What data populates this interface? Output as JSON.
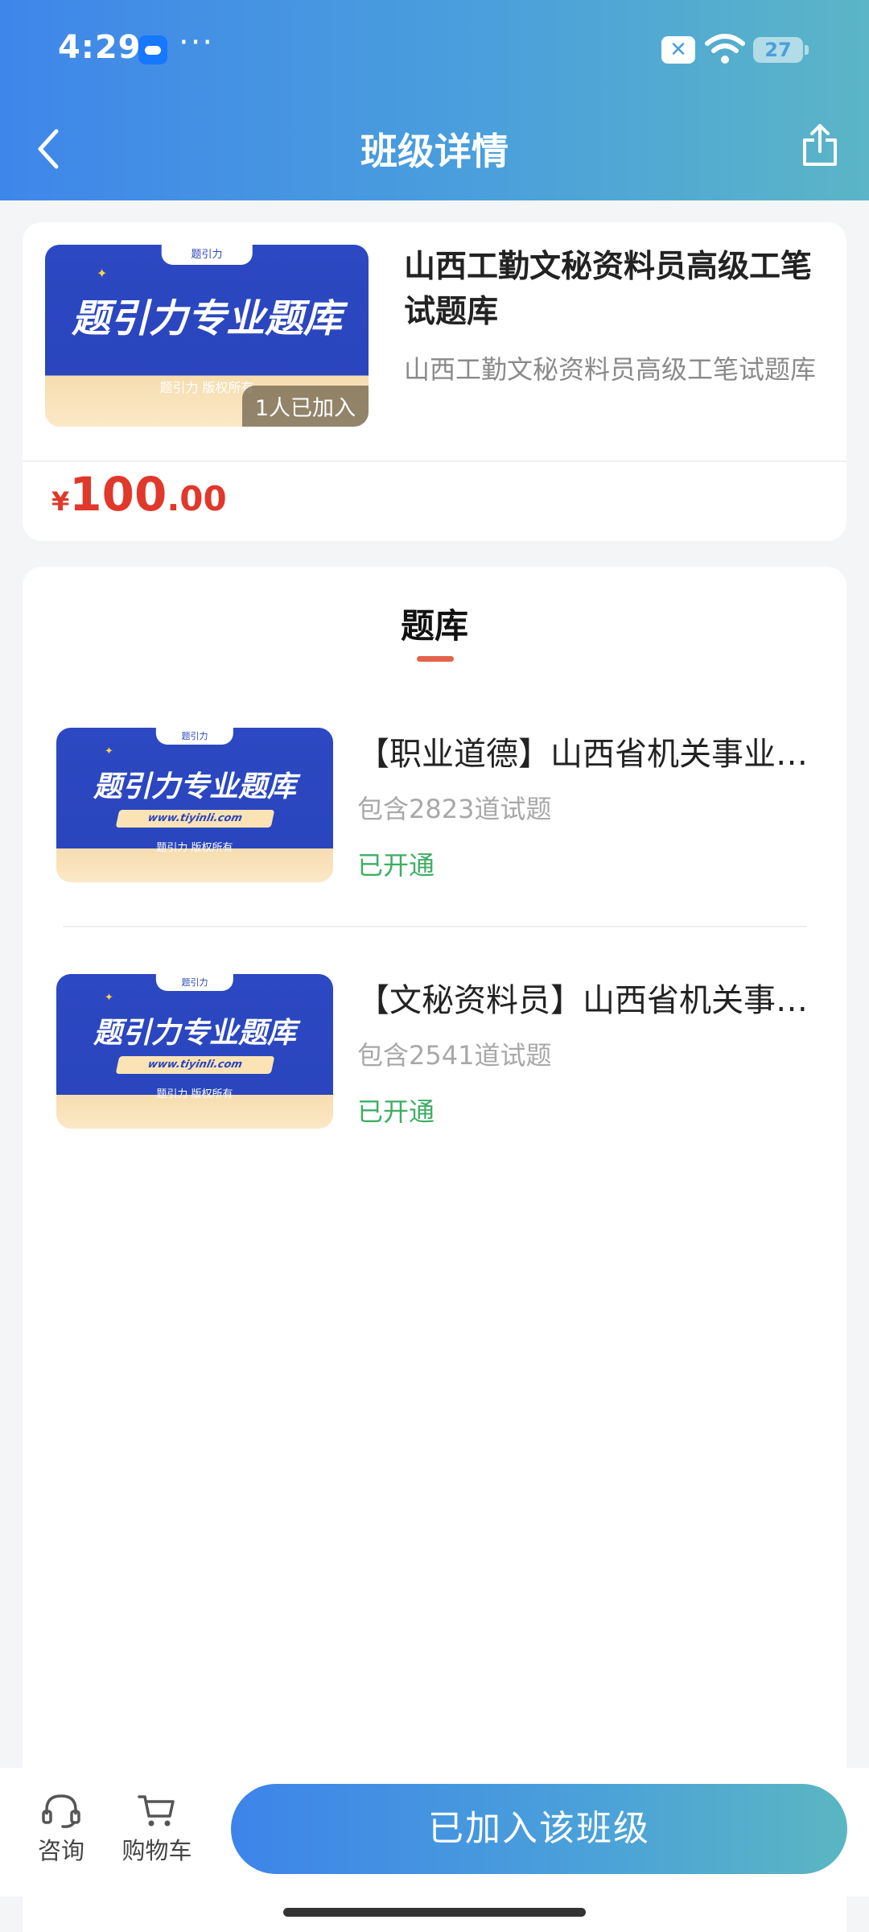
{
  "status_bar": {
    "time": "4:29",
    "more": "···",
    "battery": "27"
  },
  "header": {
    "title": "班级详情"
  },
  "cover": {
    "headline": "题引力专业题库",
    "brand": "题引力",
    "copyright": "题引力 版权所有",
    "url": "www.tiyinli.com"
  },
  "class_info": {
    "title": "山西工勤文秘资料员高级工笔试题库",
    "description": "山西工勤文秘资料员高级工笔试题库",
    "joined_count": "1人已加入",
    "price_currency": "¥",
    "price_integer": "100",
    "price_decimal": ".00"
  },
  "question_banks": {
    "heading": "题库",
    "items": [
      {
        "title": "【职业道德】山西省机关事业单位工勤技能岗位考试",
        "count": "包含2823道试题",
        "status": "已开通"
      },
      {
        "title": "【文秘资料员】山西省机关事业单位工勤技能岗位考试",
        "count": "包含2541道试题",
        "status": "已开通"
      }
    ]
  },
  "bottom_bar": {
    "consult_label": "咨询",
    "cart_label": "购物车",
    "join_button": "已加入该班级"
  },
  "colors": {
    "header_start": "#3f86ea",
    "header_end": "#5bb5c7",
    "price": "#e0382b",
    "status_green": "#3fae63",
    "accent_underline": "#e3644a"
  }
}
